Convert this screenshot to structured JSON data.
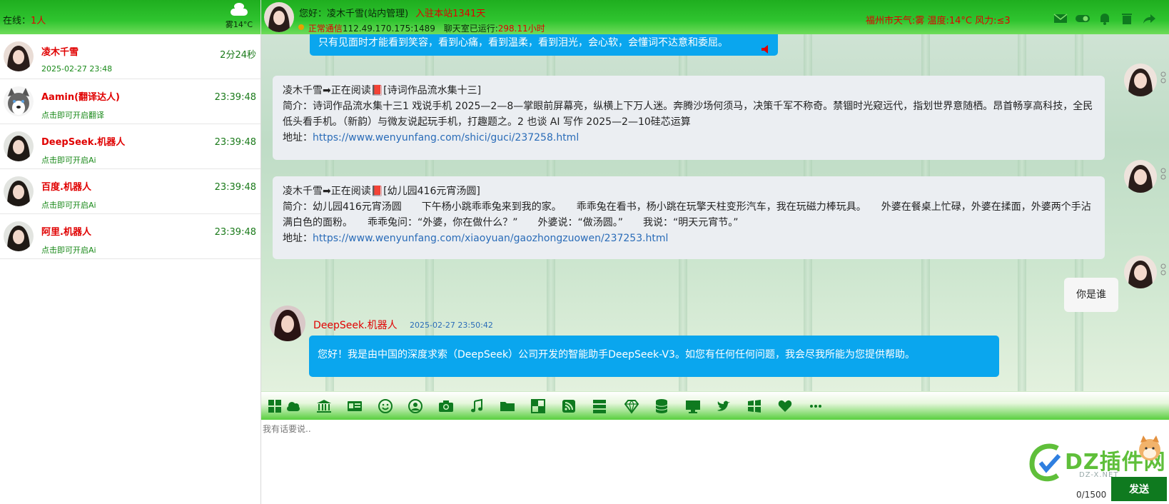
{
  "sidebar": {
    "online_label": "在线：",
    "online_count": "1人",
    "weather_temp": "雾14°C",
    "contacts": [
      {
        "name": "凌木千雪",
        "sub": "2025-02-27 23:48",
        "time": "2分24秒"
      },
      {
        "name": "Aamin(翻译达人)",
        "sub": "点击即可开启翻译",
        "time": "23:39:48"
      },
      {
        "name": "DeepSeek.机器人",
        "sub": "点击即可开启Ai",
        "time": "23:39:48"
      },
      {
        "name": "百度.机器人",
        "sub": "点击即可开启Ai",
        "time": "23:39:48"
      },
      {
        "name": "阿里.机器人",
        "sub": "点击即可开启Ai",
        "time": "23:39:48"
      }
    ]
  },
  "header": {
    "greeting": "您好：凌木千雪(站内管理)",
    "days": "入驻本站1341天",
    "status_label": "正常通信",
    "ip": "112.49.170.175:1489",
    "uptime_label": "聊天室已运行:",
    "uptime_value": "298.11小时",
    "weather": "福州市天气:雾 温度:14°C 风力:≤3"
  },
  "messages": {
    "top_bubble": "只有见面时才能看到笑容，看到心痛，看到温柔，看到泪光，会心软，会懂词不达意和委屈。",
    "card1": {
      "title": "凌木千雪➡正在阅读📕[诗词作品流水集十三]",
      "intro_label": "简介：",
      "intro": "诗词作品流水集十三1 戏说手机 2025—2—8—掌眼前屏幕亮，纵横上下万人迷。奔腾沙场何须马，决策千军不称奇。禁锢时光窥远代，指划世界意随栖。昂首畅享高科技，全民低头看手机。（新韵）与微友说起玩手机，打趣题之。2 也谈 AI 写作 2025—2—10硅芯运算",
      "url_label": "地址：",
      "url": "https://www.wenyunfang.com/shici/guci/237258.html"
    },
    "card2": {
      "title": "凌木千雪➡正在阅读📕[幼儿园416元宵汤圆]",
      "intro_label": "简介：",
      "intro": "幼儿园416元宵汤圆　　下午杨小跳乖乖兔来到我的家。　　乖乖兔在看书，杨小跳在玩擎天柱变形汽车，我在玩磁力棒玩具。　　外婆在餐桌上忙碌，外婆在揉面，外婆两个手沾满白色的面粉。　　乖乖兔问：“外婆，你在做什么？”　　外婆说：“做汤圆。”　　我说：“明天元宵节。”",
      "url_label": "地址：",
      "url": "https://www.wenyunfang.com/xiaoyuan/gaozhongzuowen/237253.html"
    },
    "user_msg": "你是谁",
    "bot_name": "DeepSeek.机器人",
    "bot_time": "2025-02-27 23:50:42",
    "bot_msg": "您好！我是由中国的深度求索（DeepSeek）公司开发的智能助手DeepSeek-V3。如您有任何任何问题，我会尽我所能为您提供帮助。"
  },
  "toolbar_icons": [
    "grid-icon",
    "cloud-icon",
    "bank-icon",
    "card-icon",
    "smile-icon",
    "user-circle-icon",
    "camera-icon",
    "music-icon",
    "folder-icon",
    "puzzle-icon",
    "rss-icon",
    "server-icon",
    "diamond-icon",
    "database-icon",
    "monitor-icon",
    "twitter-icon",
    "windows-icon",
    "heart-icon",
    "more-icon"
  ],
  "input": {
    "placeholder": "我有话要说..",
    "counter": "0/1500",
    "send": "发送"
  },
  "watermark": {
    "text": "DZ插件网",
    "sub": "DZ-X.NET"
  },
  "colors": {
    "header_green": "#2fc42f",
    "accent_red": "#e00000",
    "bubble_blue": "#0aa6ee",
    "send_green": "#0f7a1f"
  }
}
